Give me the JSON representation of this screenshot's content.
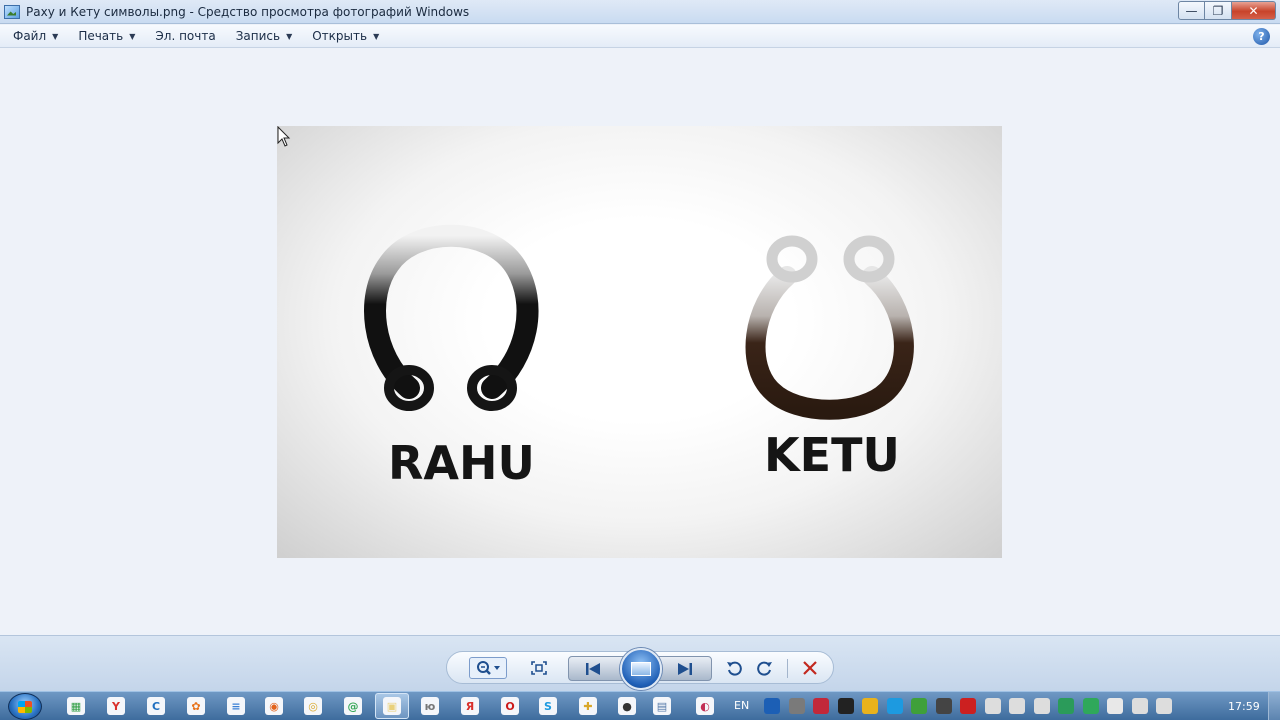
{
  "window": {
    "title": "Раху и Кету символы.png - Средство просмотра фотографий Windows",
    "minimize_glyph": "—",
    "maximize_glyph": "❐",
    "close_glyph": "✕"
  },
  "menu": {
    "items": [
      {
        "label": "Файл",
        "has_dropdown": true
      },
      {
        "label": "Печать",
        "has_dropdown": true
      },
      {
        "label": "Эл. почта",
        "has_dropdown": false
      },
      {
        "label": "Запись",
        "has_dropdown": true
      },
      {
        "label": "Открыть",
        "has_dropdown": true
      }
    ],
    "dropdown_glyph": "▼",
    "help_glyph": "?"
  },
  "photo": {
    "left_label": "RAHU",
    "right_label": "KETU"
  },
  "controls": {
    "icons": [
      "zoom-icon",
      "fit-to-window-icon",
      "previous-icon",
      "slideshow-icon",
      "next-icon",
      "rotate-left-icon",
      "rotate-right-icon",
      "delete-icon"
    ]
  },
  "taskbar": {
    "language": "EN",
    "clock": "17:59",
    "apps": [
      {
        "name": "spreadsheet",
        "glyph": "▦",
        "color": "#2f9e44"
      },
      {
        "name": "yandex-browser",
        "glyph": "Y",
        "color": "#d9302c"
      },
      {
        "name": "blue-app",
        "glyph": "C",
        "color": "#1f6fc0"
      },
      {
        "name": "media-app",
        "glyph": "✿",
        "color": "#e8731c"
      },
      {
        "name": "document",
        "glyph": "≡",
        "color": "#3a7fd5"
      },
      {
        "name": "firefox",
        "glyph": "◉",
        "color": "#e2621b"
      },
      {
        "name": "chrome",
        "glyph": "◎",
        "color": "#d9a72a"
      },
      {
        "name": "email-app",
        "glyph": "@",
        "color": "#39a85a"
      },
      {
        "name": "photo-viewer",
        "glyph": "▣",
        "color": "#e9d07a"
      },
      {
        "name": "app-10",
        "glyph": "ю",
        "color": "#777777"
      },
      {
        "name": "yandex",
        "glyph": "Я",
        "color": "#d9302c"
      },
      {
        "name": "opera",
        "glyph": "O",
        "color": "#cc1b1b"
      },
      {
        "name": "skype",
        "glyph": "S",
        "color": "#1d9ae0"
      },
      {
        "name": "app-14",
        "glyph": "✚",
        "color": "#d9a72a"
      },
      {
        "name": "app-15",
        "glyph": "●",
        "color": "#333333"
      },
      {
        "name": "app-16",
        "glyph": "▤",
        "color": "#5478a8"
      },
      {
        "name": "app-17",
        "glyph": "◐",
        "color": "#c22f56"
      }
    ]
  }
}
